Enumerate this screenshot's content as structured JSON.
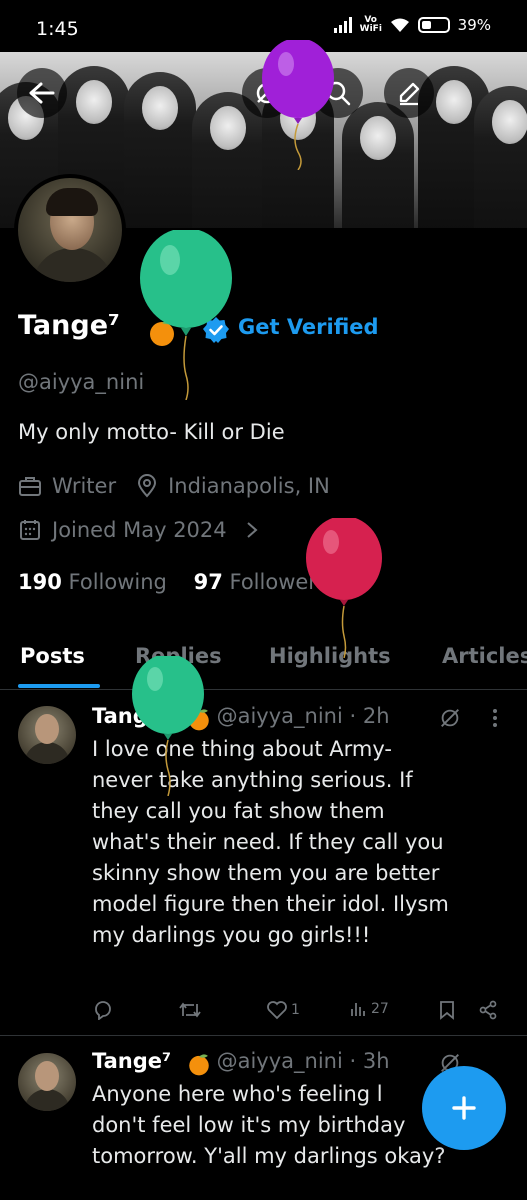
{
  "status": {
    "time": "1:45",
    "network": "Vo WiFi",
    "battery": "39%"
  },
  "profile": {
    "name": "Tange⁷",
    "get_verified": "Get Verified",
    "handle": "@aiyya_nini",
    "bio": "My only motto- Kill or Die",
    "profession": "Writer",
    "location": "Indianapolis, IN",
    "joined": "Joined May 2024",
    "following_count": "190",
    "following_label": "Following",
    "followers_count": "97",
    "followers_label": "Followers"
  },
  "tabs": [
    "Posts",
    "Replies",
    "Highlights",
    "Articles"
  ],
  "posts": [
    {
      "name": "Tange⁷",
      "handle": "@aiyya_nini",
      "time": "2h",
      "text": [
        "I love one thing about Army-",
        "never take anything serious. If",
        "they call you fat show them",
        "what's their need. If they call you",
        "skinny show them you are better",
        "model figure then their idol. Ilysm",
        "my darlings you go girls!!!"
      ],
      "likes": "1",
      "views": "27"
    },
    {
      "name": "Tange⁷",
      "handle": "@aiyya_nini",
      "time": "3h",
      "text": [
        "Anyone here who's feeling l",
        "don't feel low it's my birthday",
        "tomorrow. Y'all my darlings okay?"
      ]
    }
  ],
  "colors": {
    "accent": "#1d9bf0",
    "muted": "#71767b",
    "background": "#000000"
  },
  "icons": [
    "back-arrow-icon",
    "search-icon",
    "edit-icon",
    "orange-emoji-icon",
    "verified-badge-icon",
    "briefcase-icon",
    "location-pin-icon",
    "calendar-icon",
    "chevron-right-icon",
    "grok-icon",
    "more-icon",
    "reply-icon",
    "retweet-icon",
    "like-icon",
    "views-icon",
    "bookmark-icon",
    "share-icon",
    "compose-plus-icon"
  ]
}
